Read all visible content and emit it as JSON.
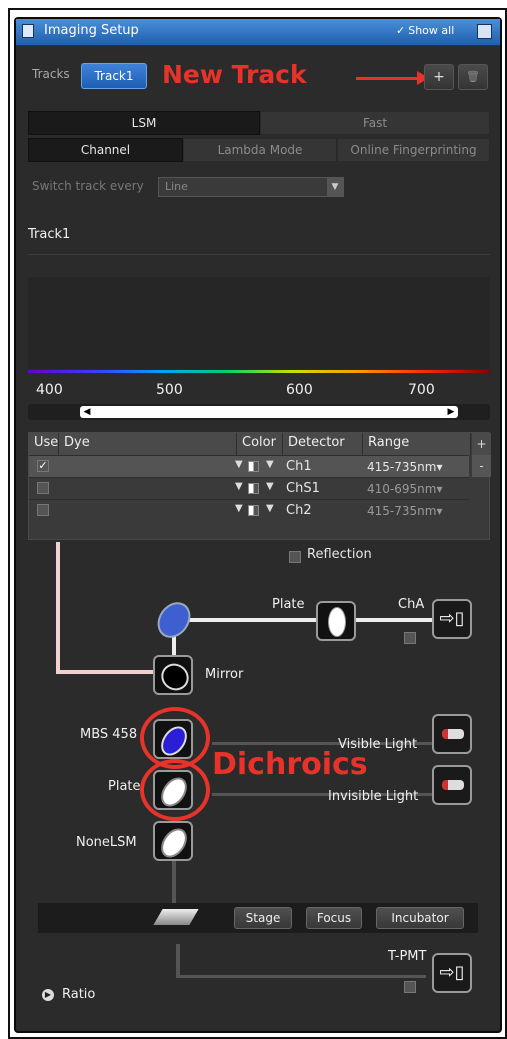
{
  "window": {
    "title": "Imaging Setup",
    "show_all": "Show all",
    "check_glyph": "✓"
  },
  "tracks": {
    "label": "Tracks",
    "selected": "Track1",
    "add_glyph": "+",
    "delete_glyph": "🗑"
  },
  "annotations": {
    "new_track": "New Track",
    "dichroics": "Dichroics"
  },
  "mode_tabs": [
    {
      "label": "LSM",
      "active": true
    },
    {
      "label": "Fast",
      "active": false
    }
  ],
  "sub_tabs": [
    {
      "label": "Channel",
      "active": true
    },
    {
      "label": "Lambda Mode",
      "active": false
    },
    {
      "label": "Online Fingerprinting",
      "active": false
    }
  ],
  "switch_track": {
    "label": "Switch track every",
    "value": "Line"
  },
  "track_title": "Track1",
  "spectrum": {
    "ticks": [
      "400",
      "500",
      "600",
      "700"
    ],
    "scroll_left": "◀",
    "scroll_right": "▶"
  },
  "channel_table": {
    "headers": {
      "use": "Use",
      "dye": "Dye",
      "color": "Color",
      "detector": "Detector",
      "range": "Range"
    },
    "plus": "+",
    "minus": "-",
    "rows": [
      {
        "checked": "✓",
        "detector": "Ch1",
        "range": "415-735nm"
      },
      {
        "checked": "",
        "detector": "ChS1",
        "range": "410-695nm"
      },
      {
        "checked": "",
        "detector": "Ch2",
        "range": "415-735nm"
      }
    ]
  },
  "reflection": "Reflection",
  "light_path": {
    "plate_top": "Plate",
    "cha": "ChA",
    "mirror": "Mirror",
    "mbs": "MBS 458",
    "plate": "Plate",
    "none_lsm": "NoneLSM",
    "visible_light": "Visible Light",
    "invisible_light": "Invisible Light",
    "t_pmt": "T-PMT",
    "detector_glyph": "⇨▯"
  },
  "state_buttons": {
    "stage": "Stage",
    "focus": "Focus",
    "incubator": "Incubator"
  },
  "ratio": {
    "label": "Ratio",
    "glyph": "▶"
  },
  "colors": {
    "accent": "#2f74c9",
    "annotation": "#e8332a",
    "mbs_filter": "#2a1fd6"
  }
}
